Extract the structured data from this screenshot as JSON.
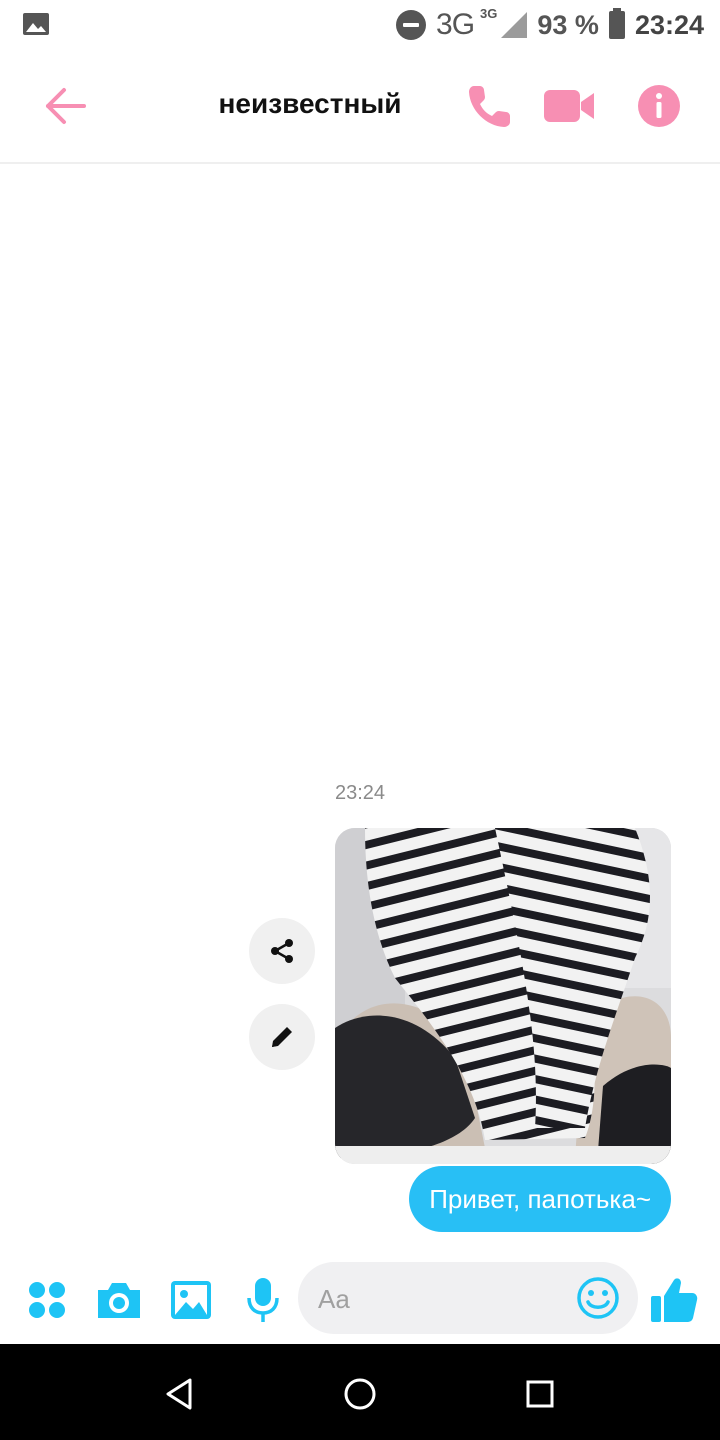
{
  "status_bar": {
    "network": "3G",
    "network_small": "3G",
    "battery_percent": "93 %",
    "time": "23:24",
    "icons": [
      "gallery-notification-icon",
      "do-not-disturb-icon",
      "signal-icon",
      "battery-charging-icon"
    ]
  },
  "header": {
    "title": "неизвестный",
    "icons": [
      "back-arrow-icon",
      "phone-icon",
      "video-camera-icon",
      "info-icon"
    ],
    "accent_color": "#f78fb3"
  },
  "conversation": {
    "timestamp": "23:24",
    "messages": [
      {
        "type": "image",
        "description_icon": "photo",
        "actions": [
          "share-icon",
          "edit-icon"
        ]
      },
      {
        "type": "text",
        "text": "Привет, папотька~",
        "bubble_color": "#28bff5"
      }
    ]
  },
  "composer": {
    "placeholder": "Aa",
    "icons": [
      "apps-icon",
      "camera-icon",
      "gallery-icon",
      "microphone-icon",
      "emoji-icon",
      "thumbs-up-icon"
    ],
    "accent_color": "#1ec4f5"
  },
  "nav_bar": {
    "icons": [
      "nav-back-icon",
      "nav-home-icon",
      "nav-recents-icon"
    ]
  }
}
